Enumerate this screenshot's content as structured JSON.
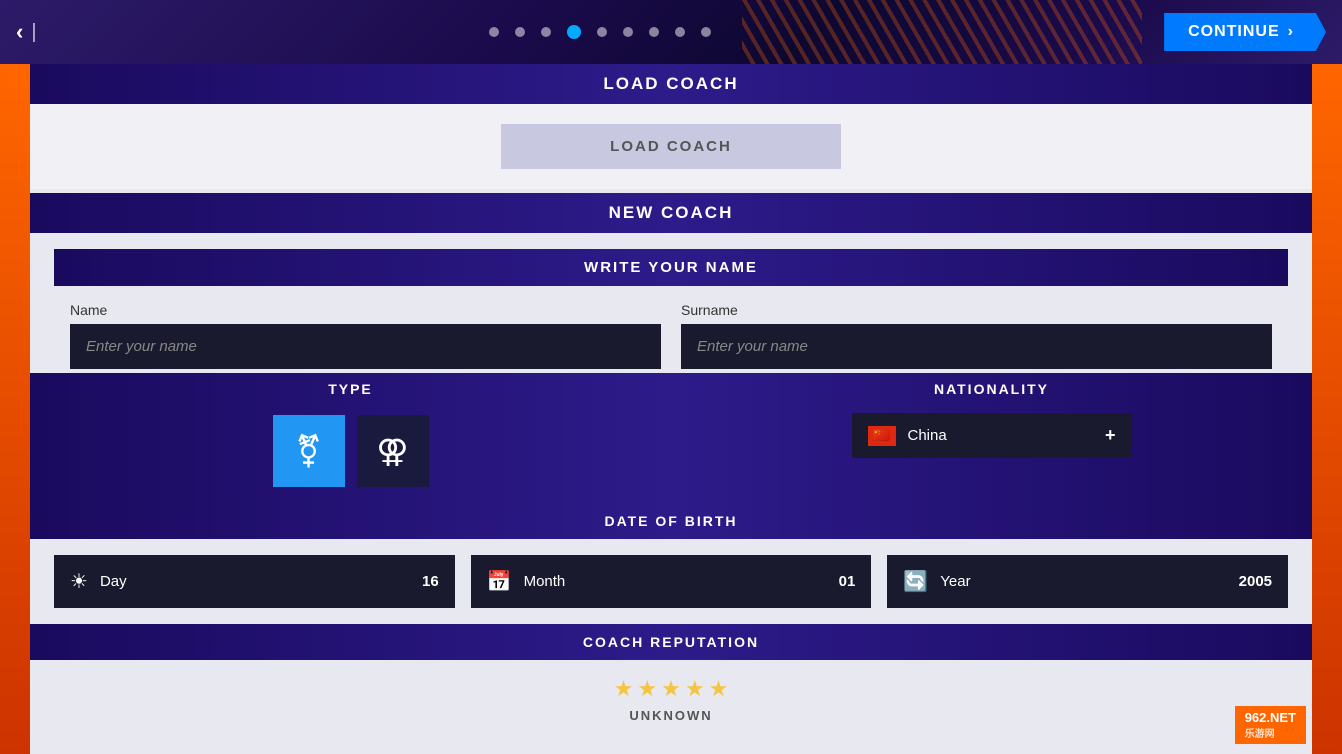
{
  "topbar": {
    "back_icon": "‹",
    "separator": "|",
    "continue_label": "CONTINUE",
    "continue_arrow": "›",
    "dots": [
      {
        "id": 1,
        "active": false
      },
      {
        "id": 2,
        "active": false
      },
      {
        "id": 3,
        "active": false
      },
      {
        "id": 4,
        "active": true
      },
      {
        "id": 5,
        "active": false
      },
      {
        "id": 6,
        "active": false
      },
      {
        "id": 7,
        "active": false
      },
      {
        "id": 8,
        "active": false
      },
      {
        "id": 9,
        "active": false
      }
    ]
  },
  "load_coach": {
    "section_title": "LOAD COACH",
    "button_label": "LOAD COACH"
  },
  "new_coach": {
    "section_title": "NEW COACH",
    "write_name_title": "WRITE YOUR NAME",
    "name_label": "Name",
    "name_placeholder": "Enter your name",
    "surname_label": "Surname",
    "surname_placeholder": "Enter your name",
    "type_label": "TYPE",
    "nationality_label": "NATIONALITY",
    "nationality_value": "China",
    "nationality_plus": "+",
    "dob_label": "DATE OF BIRTH",
    "day_label": "Day",
    "day_value": "16",
    "month_label": "Month",
    "month_value": "01",
    "year_label": "Year",
    "year_value": "2005",
    "reputation_label": "COACH REPUTATION",
    "reputation_status": "UNKNOWN",
    "stars_count": 5
  },
  "watermark": {
    "text": "962.NET",
    "sub": "乐游网"
  },
  "colors": {
    "primary_dark": "#1a0a5e",
    "primary_blue": "#007bff",
    "accent_orange": "#ff6600",
    "male_blue": "#2196F3",
    "star_yellow": "#f4c542"
  }
}
